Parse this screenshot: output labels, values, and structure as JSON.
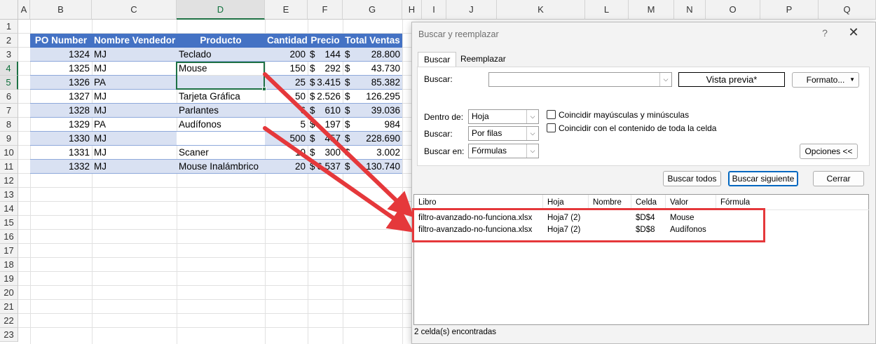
{
  "columns": [
    "A",
    "B",
    "C",
    "D",
    "E",
    "F",
    "G",
    "H",
    "I",
    "J",
    "K",
    "L",
    "M",
    "N",
    "O",
    "P",
    "Q"
  ],
  "rows": [
    "1",
    "2",
    "3",
    "4",
    "5",
    "6",
    "7",
    "8",
    "9",
    "10",
    "11",
    "12",
    "13",
    "14",
    "15",
    "16",
    "17",
    "18",
    "19",
    "20",
    "21",
    "22",
    "23"
  ],
  "table": {
    "headers": [
      "PO Number",
      "Nombre Vendedor",
      "Producto",
      "Cantidad",
      "Precio",
      "Total Ventas"
    ],
    "rows": [
      {
        "po": "1324",
        "vendor": "MJ",
        "product": "Teclado",
        "qty": "200",
        "price_sym": "$",
        "price": "144",
        "total_sym": "$",
        "total": "28.800"
      },
      {
        "po": "1325",
        "vendor": "MJ",
        "product": "Mouse",
        "qty": "150",
        "price_sym": "$",
        "price": "292",
        "total_sym": "$",
        "total": "43.730"
      },
      {
        "po": "1326",
        "vendor": "PA",
        "product": "",
        "qty": "25",
        "price_sym": "$",
        "price": "3.415",
        "total_sym": "$",
        "total": "85.382"
      },
      {
        "po": "1327",
        "vendor": "MJ",
        "product": "Tarjeta Gráfica",
        "qty": "50",
        "price_sym": "$",
        "price": "2.526",
        "total_sym": "$",
        "total": "126.295"
      },
      {
        "po": "1328",
        "vendor": "MJ",
        "product": "Parlantes",
        "qty": "6",
        "price_sym": "$",
        "price": "610",
        "total_sym": "$",
        "total": "39.036"
      },
      {
        "po": "1329",
        "vendor": "PA",
        "product": "Audífonos",
        "qty": "5",
        "price_sym": "$",
        "price": "197",
        "total_sym": "$",
        "total": "984"
      },
      {
        "po": "1330",
        "vendor": "MJ",
        "product": "",
        "qty": "500",
        "price_sym": "$",
        "price": "457",
        "total_sym": "$",
        "total": "228.690"
      },
      {
        "po": "1331",
        "vendor": "MJ",
        "product": "Scaner",
        "qty": "10",
        "price_sym": "$",
        "price": "300",
        "total_sym": "$",
        "total": "3.002"
      },
      {
        "po": "1332",
        "vendor": "MJ",
        "product": "Mouse Inalámbrico",
        "qty": "20",
        "price_sym": "$",
        "price": "6.537",
        "total_sym": "$",
        "total": "130.740"
      }
    ]
  },
  "dialog": {
    "title": "Buscar y reemplazar",
    "help": "?",
    "close": "✕",
    "tabs": [
      "Buscar",
      "Reemplazar"
    ],
    "find_label": "Buscar:",
    "find_value": "",
    "preview": "Vista previa*",
    "format_button": "Formato...",
    "within_label": "Dentro de:",
    "within_value": "Hoja",
    "search_label": "Buscar:",
    "search_value": "Por filas",
    "look_in_label": "Buscar en:",
    "look_in_value": "Fórmulas",
    "match_case": "Coincidir mayúsculas y minúsculas",
    "match_entire": "Coincidir con el contenido de toda la celda",
    "options_button": "Opciones <<",
    "find_all": "Buscar todos",
    "find_next": "Buscar siguiente",
    "close_button": "Cerrar",
    "results_headers": [
      "Libro",
      "Hoja",
      "Nombre",
      "Celda",
      "Valor",
      "Fórmula"
    ],
    "results": [
      {
        "book": "filtro-avanzado-no-funciona.xlsx",
        "sheet": "Hoja7 (2)",
        "name": "",
        "cell": "$D$4",
        "value": "Mouse",
        "formula": ""
      },
      {
        "book": "filtro-avanzado-no-funciona.xlsx",
        "sheet": "Hoja7 (2)",
        "name": "",
        "cell": "$D$8",
        "value": "Audífonos",
        "formula": ""
      }
    ],
    "status": "2 celda(s) encontradas"
  },
  "colors": {
    "header_blue": "#4472c4",
    "band_blue": "#d9e1f2",
    "excel_green": "#1e7145",
    "annotation_red": "#e5383b"
  }
}
